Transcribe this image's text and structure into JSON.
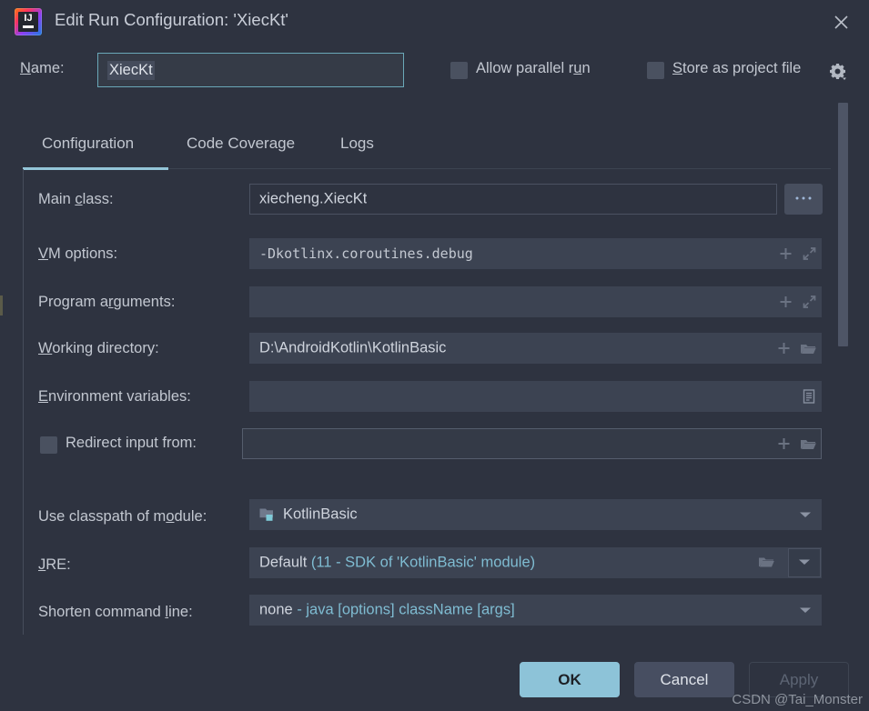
{
  "window": {
    "title": "Edit Run Configuration: 'XiecKt'",
    "app_icon": "intellij-idea-icon",
    "close_icon": "close-icon"
  },
  "name_row": {
    "label_pre": "N",
    "label_mnemonic": "N",
    "label": "Name:",
    "value": "XiecKt",
    "placeholder": ""
  },
  "options": {
    "allow_parallel_run": {
      "label": "Allow parallel run",
      "checked": false
    },
    "store_as_project_file": {
      "label": "Store as project file",
      "checked": false
    },
    "gear_icon": "gear-icon"
  },
  "tabs": [
    {
      "label": "Configuration",
      "active": true
    },
    {
      "label": "Code Coverage",
      "active": false
    },
    {
      "label": "Logs",
      "active": false
    }
  ],
  "fields": {
    "main_class": {
      "label": "Main class:",
      "value": "xiecheng.XiecKt",
      "browse_label": "...",
      "browse_icon": "ellipsis-icon"
    },
    "vm_options": {
      "label": "VM options:",
      "value": "-Dkotlinx.coroutines.debug",
      "icons": [
        "plus-icon",
        "expand-icon"
      ]
    },
    "program_arguments": {
      "label": "Program arguments:",
      "value": "",
      "icons": [
        "plus-icon",
        "expand-icon"
      ]
    },
    "working_directory": {
      "label": "Working directory:",
      "value": "D:\\AndroidKotlin\\KotlinBasic",
      "icons": [
        "plus-icon",
        "folder-icon"
      ]
    },
    "environment_variables": {
      "label": "Environment variables:",
      "value": "",
      "icons": [
        "list-icon"
      ]
    },
    "redirect_input_from": {
      "label": "Redirect input from:",
      "checked": false,
      "value": "",
      "icons": [
        "plus-icon",
        "folder-icon"
      ]
    },
    "use_classpath_of_module": {
      "label": "Use classpath of module:",
      "value": "KotlinBasic",
      "icon": "module-icon",
      "arrow_icon": "chevron-down-icon"
    },
    "jre": {
      "label": "JRE:",
      "value_main": "Default",
      "value_sub": "(11 - SDK of 'KotlinBasic' module)",
      "folder_icon": "folder-icon",
      "arrow_icon": "chevron-down-icon"
    },
    "shorten_command_line": {
      "label": "Shorten command line:",
      "value_main": "none",
      "value_sub": "- java [options] className [args]",
      "arrow_icon": "chevron-down-icon"
    }
  },
  "footer": {
    "ok": "OK",
    "cancel": "Cancel",
    "apply": "Apply"
  },
  "watermark": "CSDN @Tai_Monster",
  "colors": {
    "dialog_bg": "#2e3340",
    "accent": "#8dc3d8",
    "tab_underline": "#93c5d8",
    "focus_border": "#6aa8b8",
    "sub_text": "#7fbcd2"
  }
}
